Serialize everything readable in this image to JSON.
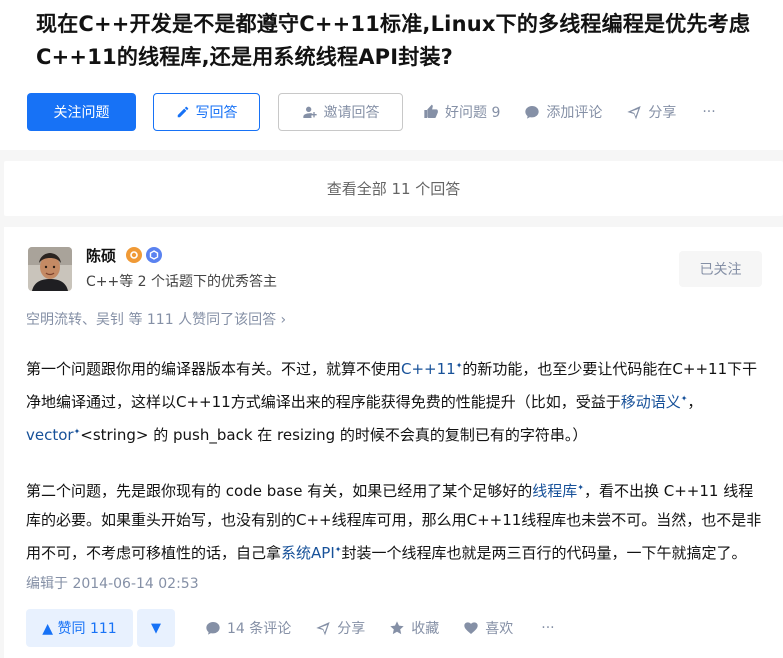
{
  "question": {
    "title": "现在C++开发是不是都遵守C++11标准,Linux下的多线程编程是优先考虑C++11的线程库,还是用系统线程API封装?",
    "follow_label": "关注问题",
    "write_answer_label": "写回答",
    "invite_label": "邀请回答",
    "good_question_label": "好问题 9",
    "add_comment_label": "添加评论",
    "share_label": "分享",
    "more_label": "···"
  },
  "view_all_label": "查看全部 11 个回答",
  "answer": {
    "author_name": "陈硕",
    "author_bio": "C++等 2 个话题下的优秀答主",
    "followed_label": "已关注",
    "voters_text": "空明流转、吴钊 等 111 人赞同了该回答 ›",
    "p1": {
      "t1": "第一个问题跟你用的编译器版本有关。不过，就算不使用",
      "k1": "C++11",
      "t2": "的新功能，也至少要让代码能在C++11下干净地编译通过，这样以C++11方式编译出来的程序能获得免费的性能提升（比如，受益于",
      "k2": "移动语义",
      "t3": "，",
      "k3": "vector",
      "t4": "<string> 的 push_back 在 resizing 的时候不会真的复制已有的字符串。）"
    },
    "p2": {
      "t1": "第二个问题，先是跟你现有的 code base 有关，如果已经用了某个足够好的",
      "k1": "线程库",
      "t2": "，看不出换 C++11 线程库的必要。如果重头开始写，也没有别的C++线程库可用，那么用C++11线程库也未尝不可。当然，也不是非用不可，不考虑可移植性的话，自己拿",
      "k2": "系统API",
      "t3": "封装一个线程库也就是两三百行的代码量，一下午就搞定了。"
    },
    "keyword_mark": "✦",
    "edited_text": "编辑于 2014-06-14 02:53",
    "vote_up_label": "▲ 赞同 111",
    "vote_down_label": "▼",
    "comments_label": "14 条评论",
    "share_label": "分享",
    "favorite_label": "收藏",
    "like_label": "喜欢",
    "more_label": "···"
  },
  "colors": {
    "brand_blue": "#1772f6",
    "link_blue": "#175199",
    "meta_gray": "#8590a6"
  }
}
